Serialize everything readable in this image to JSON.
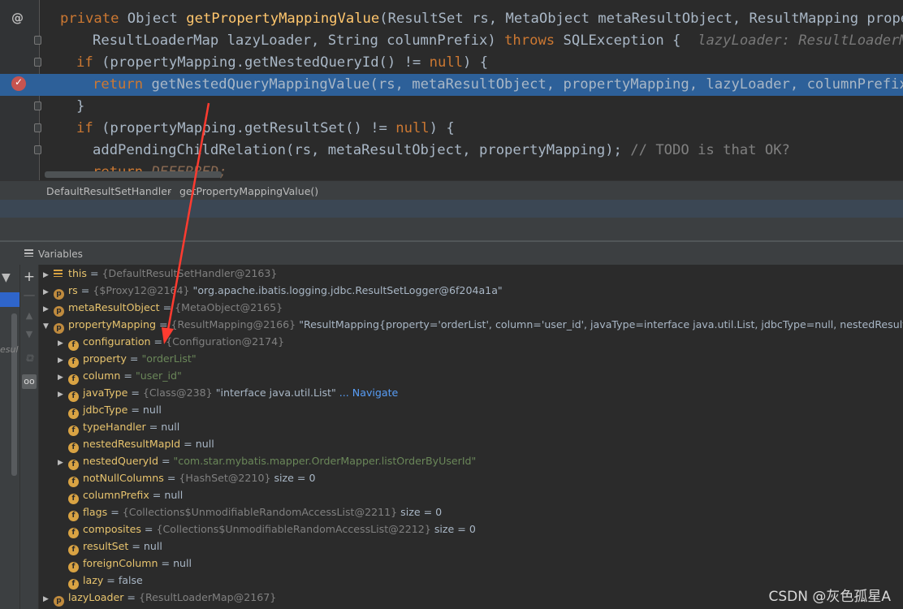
{
  "editor": {
    "line1": {
      "kw": "private",
      "type": "Object",
      "fn": "getPropertyMappingValue",
      "params": "(ResultSet rs, MetaObject metaResultObject, ResultMapping property"
    },
    "line2": {
      "params": "ResultLoaderMap lazyLoader, String columnPrefix)",
      "kw": "throws",
      "exc": "SQLException {",
      "hint": "lazyLoader: ResultLoaderMap@"
    },
    "line3": {
      "kw": "if",
      "text": "(propertyMapping.getNestedQueryId() !=",
      "null": "null",
      "end": ") {"
    },
    "line4": {
      "kw": "return",
      "text": "getNestedQueryMappingValue(rs, metaResultObject, propertyMapping, lazyLoader, columnPrefix);"
    },
    "line5": {
      "text": "}"
    },
    "line6": {
      "kw": "if",
      "text": "(propertyMapping.getResultSet() !=",
      "null": "null",
      "end": ") {"
    },
    "line7": {
      "text": "addPendingChildRelation(rs, metaResultObject, propertyMapping);",
      "comment": "// TODO is that OK?"
    },
    "line8": {
      "kw": "return",
      "text": "DEFERRED;"
    }
  },
  "breadcrumb": {
    "class_name": "DefaultResultSetHandler",
    "separator": "›",
    "method": "getPropertyMappingValue()"
  },
  "variables": {
    "title": "Variables",
    "frames_ghost_text": "esul",
    "rows": [
      {
        "icon": "this-icon",
        "name": "this",
        "eq": " = ",
        "ref": "{DefaultResultSetHandler@2163}",
        "str": "",
        "extra": ""
      },
      {
        "icon": "p",
        "name": "rs",
        "eq": " = ",
        "ref": "{$Proxy12@2164}",
        "str": "\"org.apache.ibatis.logging.jdbc.ResultSetLogger@6f204a1a\"",
        "extra": ""
      },
      {
        "icon": "p",
        "name": "metaResultObject",
        "eq": " = ",
        "ref": "{MetaObject@2165}",
        "str": "",
        "extra": ""
      },
      {
        "icon": "p",
        "name": "propertyMapping",
        "eq": " = ",
        "ref": "{ResultMapping@2166}",
        "str": "\"ResultMapping{property='orderList', column='user_id', javaType=interface java.util.List, jdbcType=null, nestedResultMapId='null', n",
        "extra": ""
      },
      {
        "icon": "f",
        "name": "configuration",
        "eq": " = ",
        "ref": "{Configuration@2174}",
        "str": "",
        "extra": ""
      },
      {
        "icon": "f",
        "name": "property",
        "eq": " = ",
        "ref": "",
        "str": "\"orderList\"",
        "extra": ""
      },
      {
        "icon": "f",
        "name": "column",
        "eq": " = ",
        "ref": "",
        "str": "\"user_id\"",
        "extra": ""
      },
      {
        "icon": "f",
        "name": "javaType",
        "eq": " = ",
        "ref": "{Class@238}",
        "str": "\"interface java.util.List\"",
        "extra": "... Navigate"
      },
      {
        "icon": "f",
        "name": "jdbcType",
        "eq": " = ",
        "ref": "",
        "str": "null",
        "extra": ""
      },
      {
        "icon": "f",
        "name": "typeHandler",
        "eq": " = ",
        "ref": "",
        "str": "null",
        "extra": ""
      },
      {
        "icon": "f",
        "name": "nestedResultMapId",
        "eq": " = ",
        "ref": "",
        "str": "null",
        "extra": ""
      },
      {
        "icon": "f",
        "name": "nestedQueryId",
        "eq": " = ",
        "ref": "",
        "str": "\"com.star.mybatis.mapper.OrderMapper.listOrderByUserId\"",
        "extra": ""
      },
      {
        "icon": "f",
        "name": "notNullColumns",
        "eq": " = ",
        "ref": "{HashSet@2210}",
        "str": "size = 0",
        "extra": ""
      },
      {
        "icon": "f",
        "name": "columnPrefix",
        "eq": " = ",
        "ref": "",
        "str": "null",
        "extra": ""
      },
      {
        "icon": "f",
        "name": "flags",
        "eq": " = ",
        "ref": "{Collections$UnmodifiableRandomAccessList@2211}",
        "str": "size = 0",
        "extra": ""
      },
      {
        "icon": "f",
        "name": "composites",
        "eq": " = ",
        "ref": "{Collections$UnmodifiableRandomAccessList@2212}",
        "str": "size = 0",
        "extra": ""
      },
      {
        "icon": "f",
        "name": "resultSet",
        "eq": " = ",
        "ref": "",
        "str": "null",
        "extra": ""
      },
      {
        "icon": "f",
        "name": "foreignColumn",
        "eq": " = ",
        "ref": "",
        "str": "null",
        "extra": ""
      },
      {
        "icon": "f",
        "name": "lazy",
        "eq": " = ",
        "ref": "",
        "str": "false",
        "extra": ""
      },
      {
        "icon": "p",
        "name": "lazyLoader",
        "eq": " = ",
        "ref": "{ResultLoaderMap@2167}",
        "str": "",
        "extra": ""
      }
    ]
  },
  "watermark": "CSDN @灰色孤星A",
  "colors": {
    "highlight": "#2d6099",
    "annotation_arrow": "#ff3b30",
    "string": "#6a8759",
    "keyword": "#cc7832"
  }
}
